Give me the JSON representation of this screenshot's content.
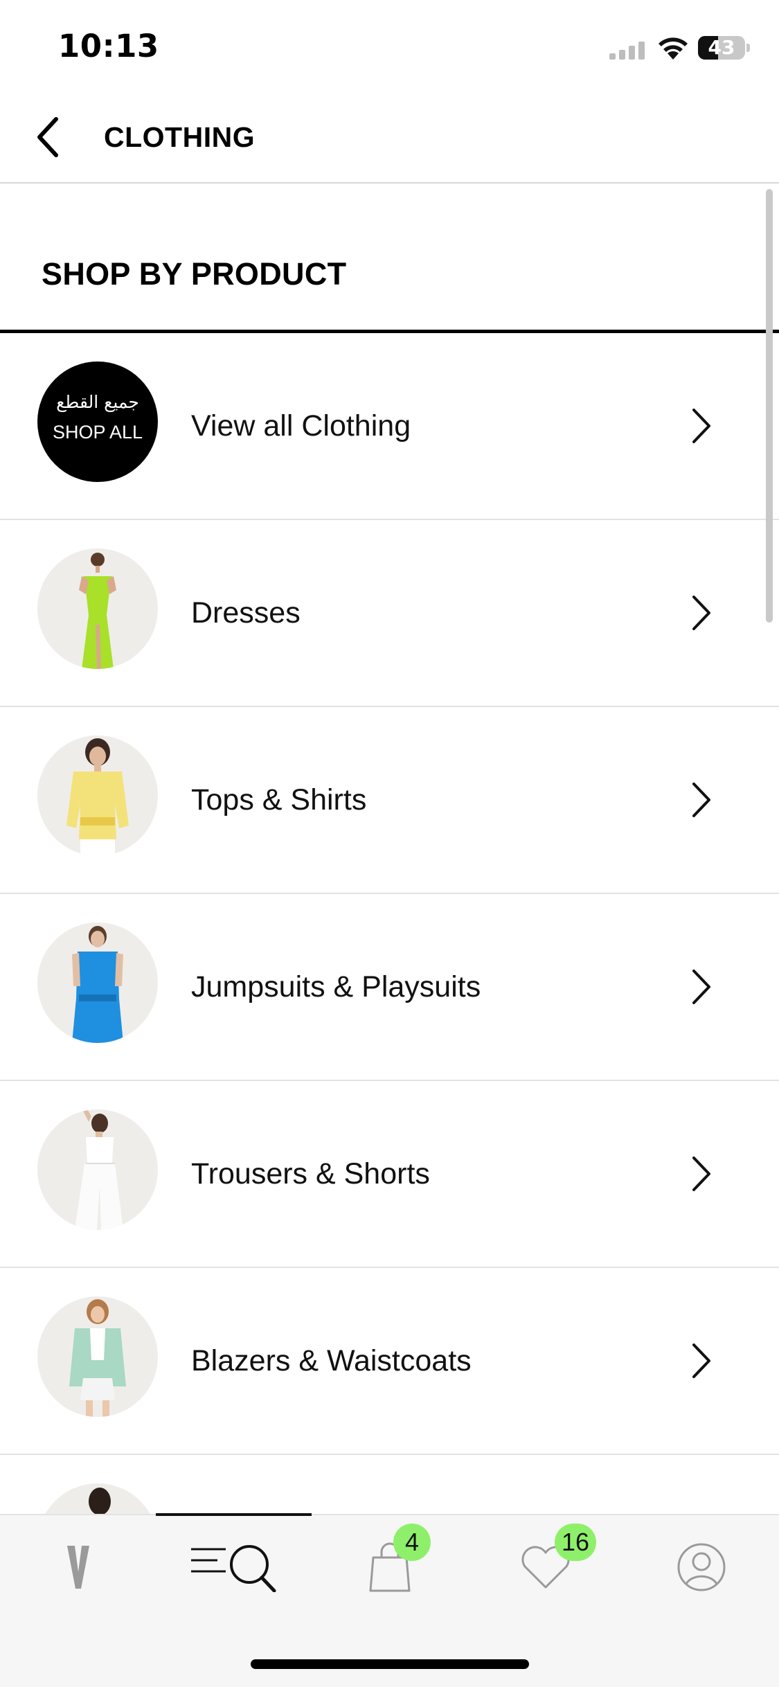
{
  "status_bar": {
    "time": "10:13",
    "battery": "43",
    "battery_level": 0.43
  },
  "header": {
    "title": "CLOTHING"
  },
  "section": {
    "title": "SHOP BY PRODUCT"
  },
  "shop_all": {
    "arabic": "جميع القطع",
    "english": "SHOP ALL"
  },
  "items": [
    {
      "label": "View all Clothing",
      "thumb": "shop-all-badge"
    },
    {
      "label": "Dresses",
      "thumb": "lime-dress-model"
    },
    {
      "label": "Tops & Shirts",
      "thumb": "yellow-top-model"
    },
    {
      "label": "Jumpsuits & Playsuits",
      "thumb": "blue-jumpsuit-model"
    },
    {
      "label": "Trousers & Shorts",
      "thumb": "white-trousers-model"
    },
    {
      "label": "Blazers & Waistcoats",
      "thumb": "mint-blazer-model"
    }
  ],
  "tab_bar": {
    "tabs": [
      {
        "name": "brand",
        "icon": "brand-v-icon"
      },
      {
        "name": "menu-search",
        "icon": "menu-search-icon",
        "active": true
      },
      {
        "name": "bag",
        "icon": "shopping-bag-icon",
        "badge": "4"
      },
      {
        "name": "wishlist",
        "icon": "heart-icon",
        "badge": "16"
      },
      {
        "name": "account",
        "icon": "user-icon"
      }
    ]
  },
  "colors": {
    "accent_badge": "#8ef06a",
    "text": "#000000",
    "divider": "#e2e2e2",
    "thumb_bg": "#efedea"
  }
}
